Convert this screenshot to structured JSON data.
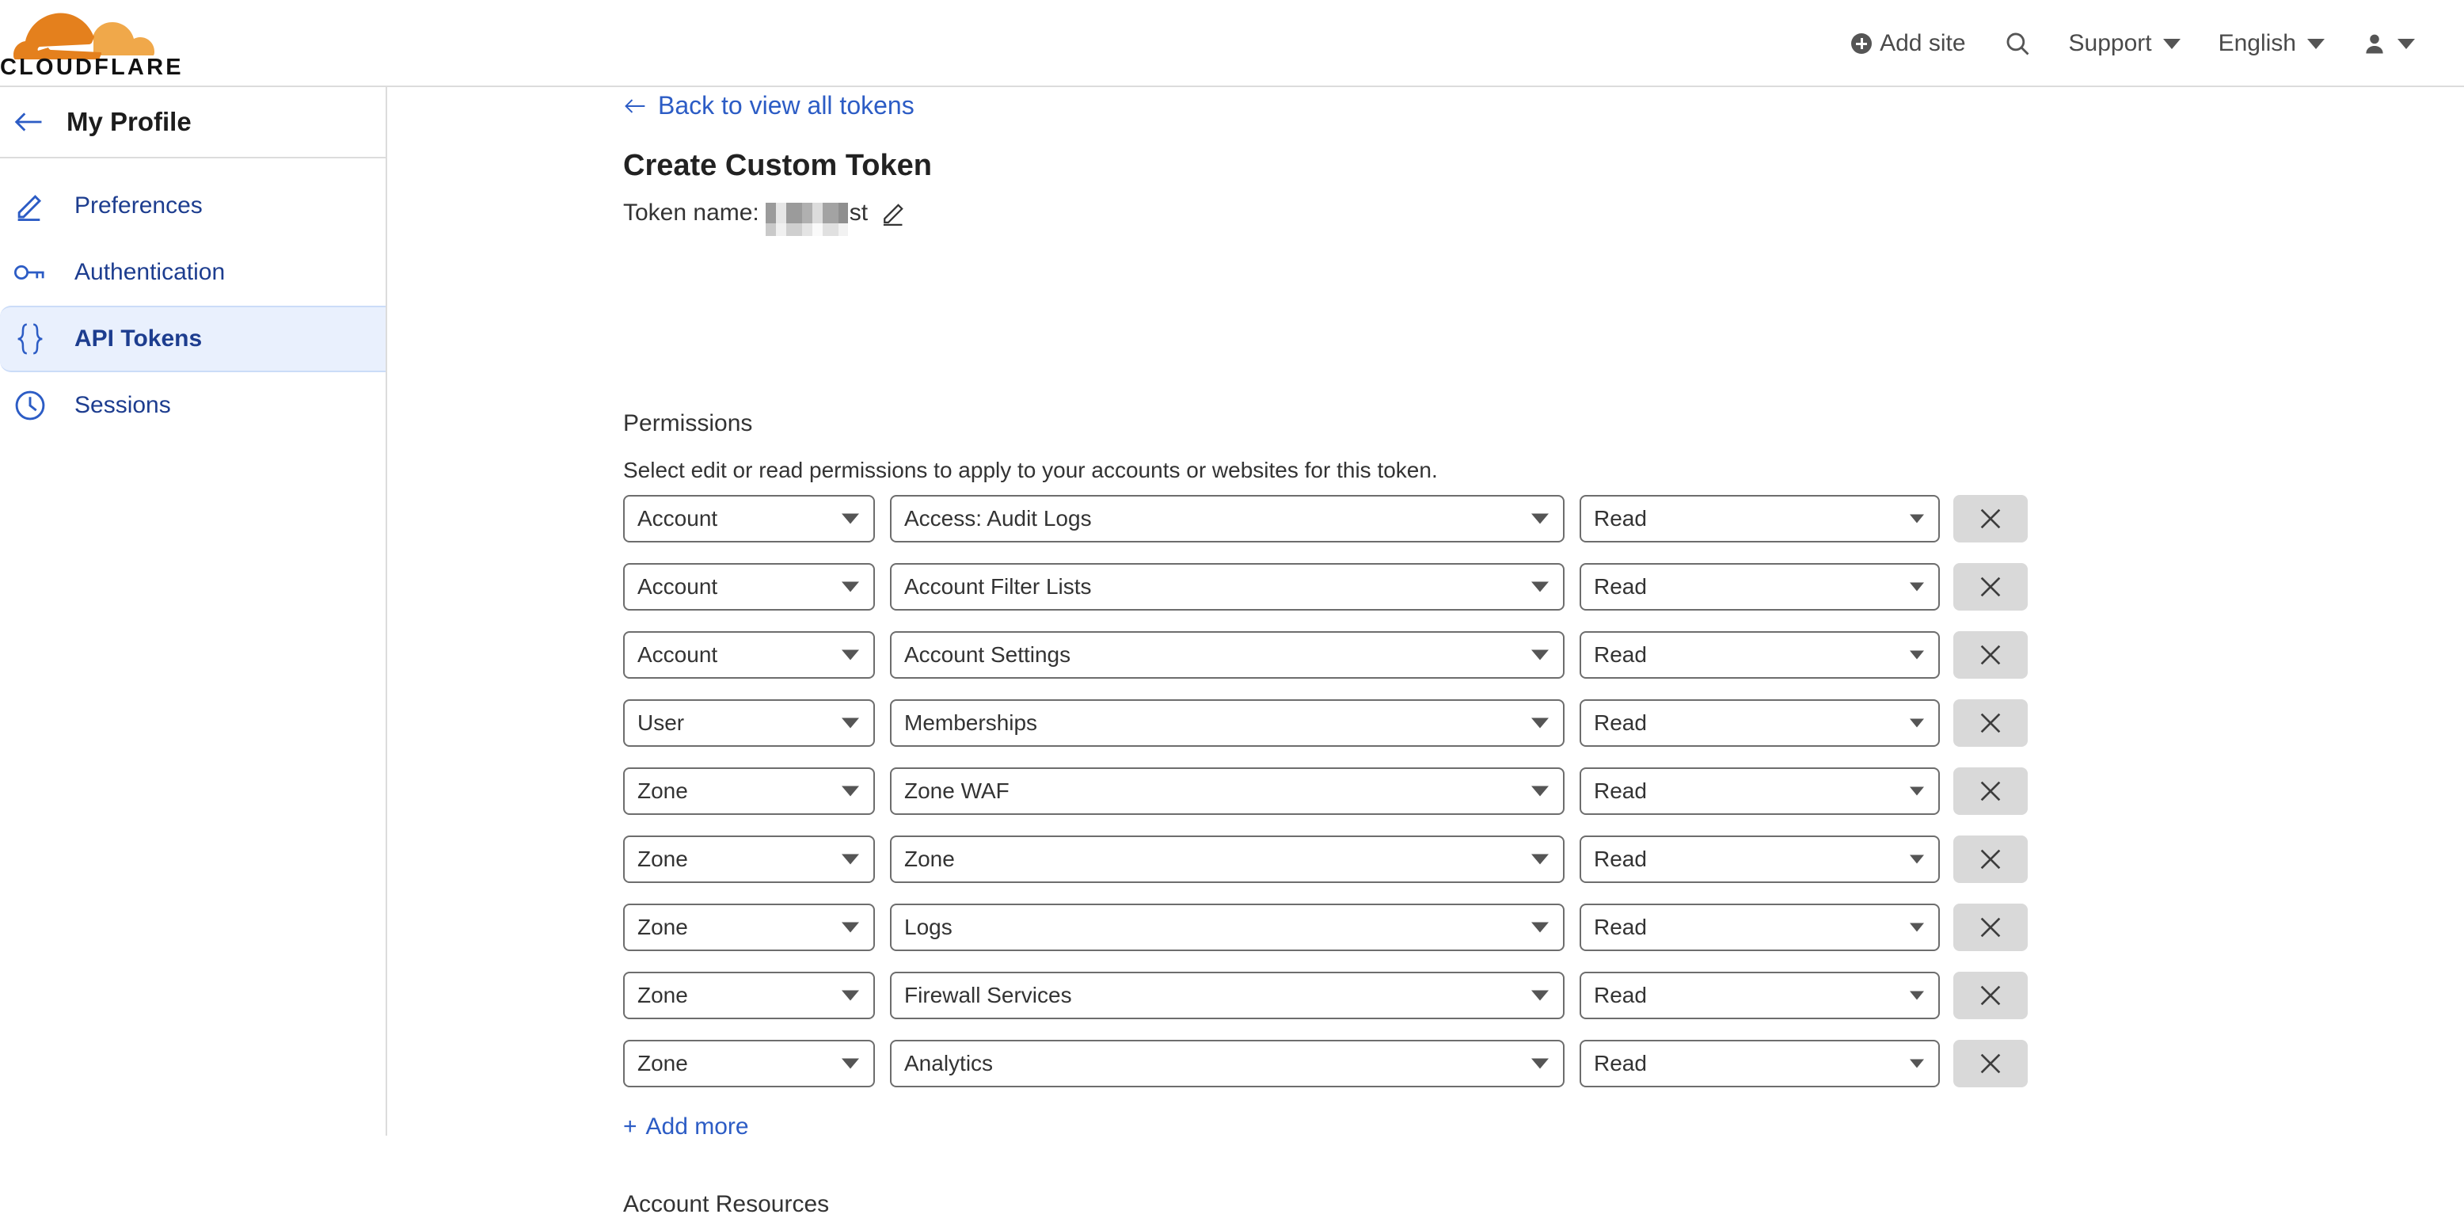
{
  "header": {
    "logo_text": "CLOUDFLARE",
    "logo_colors": {
      "cloud_dark": "#e4801d",
      "cloud_light": "#f0a84a",
      "wordmark": "#111111"
    },
    "add_site_label": "Add site",
    "search_icon": "search-icon",
    "support_label": "Support",
    "language_label": "English",
    "account_icon": "person-icon"
  },
  "sidebar": {
    "title": "My Profile",
    "back_icon": "arrow-left-icon",
    "items": [
      {
        "label": "Preferences",
        "icon": "pencil-icon",
        "active": false
      },
      {
        "label": "Authentication",
        "icon": "key-icon",
        "active": false
      },
      {
        "label": "API Tokens",
        "icon": "curly-braces-icon",
        "active": true
      },
      {
        "label": "Sessions",
        "icon": "clock-icon",
        "active": false
      }
    ],
    "active_bg": "#e9f0fd",
    "active_text": "#1d3d8f"
  },
  "main": {
    "back_link": "Back to view all tokens",
    "page_title": "Create Custom Token",
    "token_name_label": "Token name:",
    "token_name_value_suffix": "st",
    "token_name_redacted": true,
    "edit_icon": "pencil-icon",
    "permissions_heading": "Permissions",
    "permissions_description": "Select edit or read permissions to apply to your accounts or websites for this token.",
    "add_more_label": "Add more",
    "add_more_prefix": "+",
    "account_resources_heading": "Account Resources",
    "link_color": "#2c5cc5",
    "permission_rows": [
      {
        "scope": "Account",
        "resource": "Access: Audit Logs",
        "level": "Read",
        "remove": "remove-row-button"
      },
      {
        "scope": "Account",
        "resource": "Account Filter Lists",
        "level": "Read",
        "remove": "remove-row-button"
      },
      {
        "scope": "Account",
        "resource": "Account Settings",
        "level": "Read",
        "remove": "remove-row-button"
      },
      {
        "scope": "User",
        "resource": "Memberships",
        "level": "Read",
        "remove": "remove-row-button"
      },
      {
        "scope": "Zone",
        "resource": "Zone WAF",
        "level": "Read",
        "remove": "remove-row-button"
      },
      {
        "scope": "Zone",
        "resource": "Zone",
        "level": "Read",
        "remove": "remove-row-button"
      },
      {
        "scope": "Zone",
        "resource": "Logs",
        "level": "Read",
        "remove": "remove-row-button"
      },
      {
        "scope": "Zone",
        "resource": "Firewall Services",
        "level": "Read",
        "remove": "remove-row-button"
      },
      {
        "scope": "Zone",
        "resource": "Analytics",
        "level": "Read",
        "remove": "remove-row-button"
      }
    ]
  }
}
